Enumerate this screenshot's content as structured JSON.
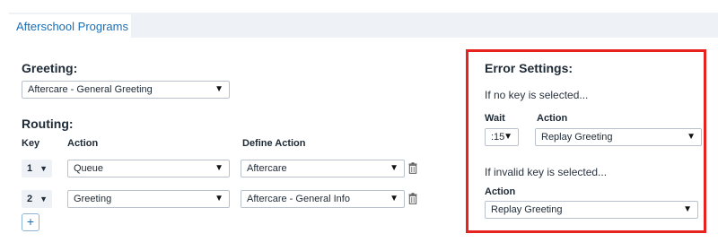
{
  "tab": {
    "label": "Afterschool Programs"
  },
  "greeting": {
    "heading": "Greeting:",
    "selected": "Aftercare - General Greeting"
  },
  "routing": {
    "heading": "Routing:",
    "headers": {
      "key": "Key",
      "action": "Action",
      "define": "Define Action"
    },
    "rows": [
      {
        "key": "1",
        "action": "Queue",
        "define": "Aftercare"
      },
      {
        "key": "2",
        "action": "Greeting",
        "define": "Aftercare - General Info"
      }
    ],
    "add_label": "+"
  },
  "error_settings": {
    "heading": "Error Settings:",
    "no_key_note": "If no key is selected...",
    "wait_label": "Wait",
    "action_label": "Action",
    "wait_value": ":15",
    "no_key_action": "Replay Greeting",
    "invalid_note": "If invalid key is selected...",
    "invalid_action_label": "Action",
    "invalid_action": "Replay Greeting",
    "highlight_color": "#e8231f"
  },
  "icons": {
    "caret": "caret-down-icon",
    "trash": "trash-icon",
    "plus": "plus-icon"
  },
  "colors": {
    "accent": "#1b6fb5",
    "tab_strip": "#eef1f5"
  }
}
